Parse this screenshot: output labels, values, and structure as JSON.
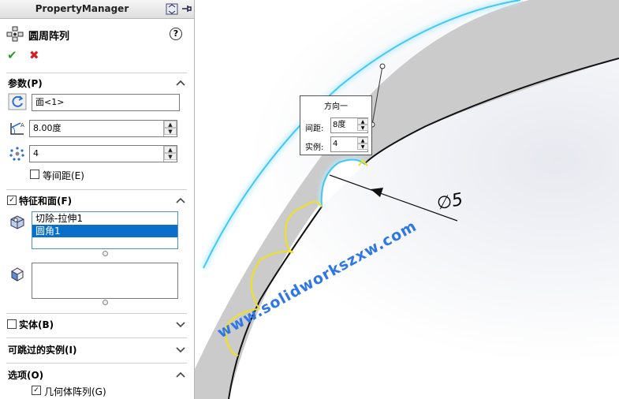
{
  "property_manager": {
    "title": "PropertyManager",
    "feature_name": "圆周阵列",
    "ok_symbol": "✔",
    "cancel_symbol": "✖",
    "help_symbol": "?",
    "parameters": {
      "title": "参数(P)",
      "axis_value": "面<1>",
      "angle_value": "8.00度",
      "instances_value": "4",
      "equal_spacing_label": "等间距(E)",
      "equal_spacing_checked": false
    },
    "features_faces": {
      "title": "特征和面(F)",
      "checked": true,
      "features_list": [
        "切除-拉伸1",
        "圆角1"
      ],
      "selected_index": 1,
      "faces_list": []
    },
    "bodies": {
      "title": "实体(B)",
      "checked": false
    },
    "skip_instances": {
      "title": "可跳过的实例(I)"
    },
    "options": {
      "title": "选项(O)",
      "geometry_pattern_label": "几何体阵列(G)",
      "geometry_pattern_checked": true
    }
  },
  "viewport": {
    "callout": {
      "title": "方向一",
      "spacing_label": "间距:",
      "spacing_value": "8度",
      "instances_label": "实例:",
      "instances_value": "4"
    },
    "dimension_text": "∅5",
    "watermark": "www.solidworkszxw.com"
  },
  "colors": {
    "selection": "#0a6fc8",
    "preview_yellow": "#f0e21a",
    "edge_cyan": "#45c8f0",
    "part_gray": "#cbcbcb",
    "ok_green": "#2a9d2a",
    "cancel_red": "#d42020",
    "watermark_blue": "#2f77e6"
  }
}
